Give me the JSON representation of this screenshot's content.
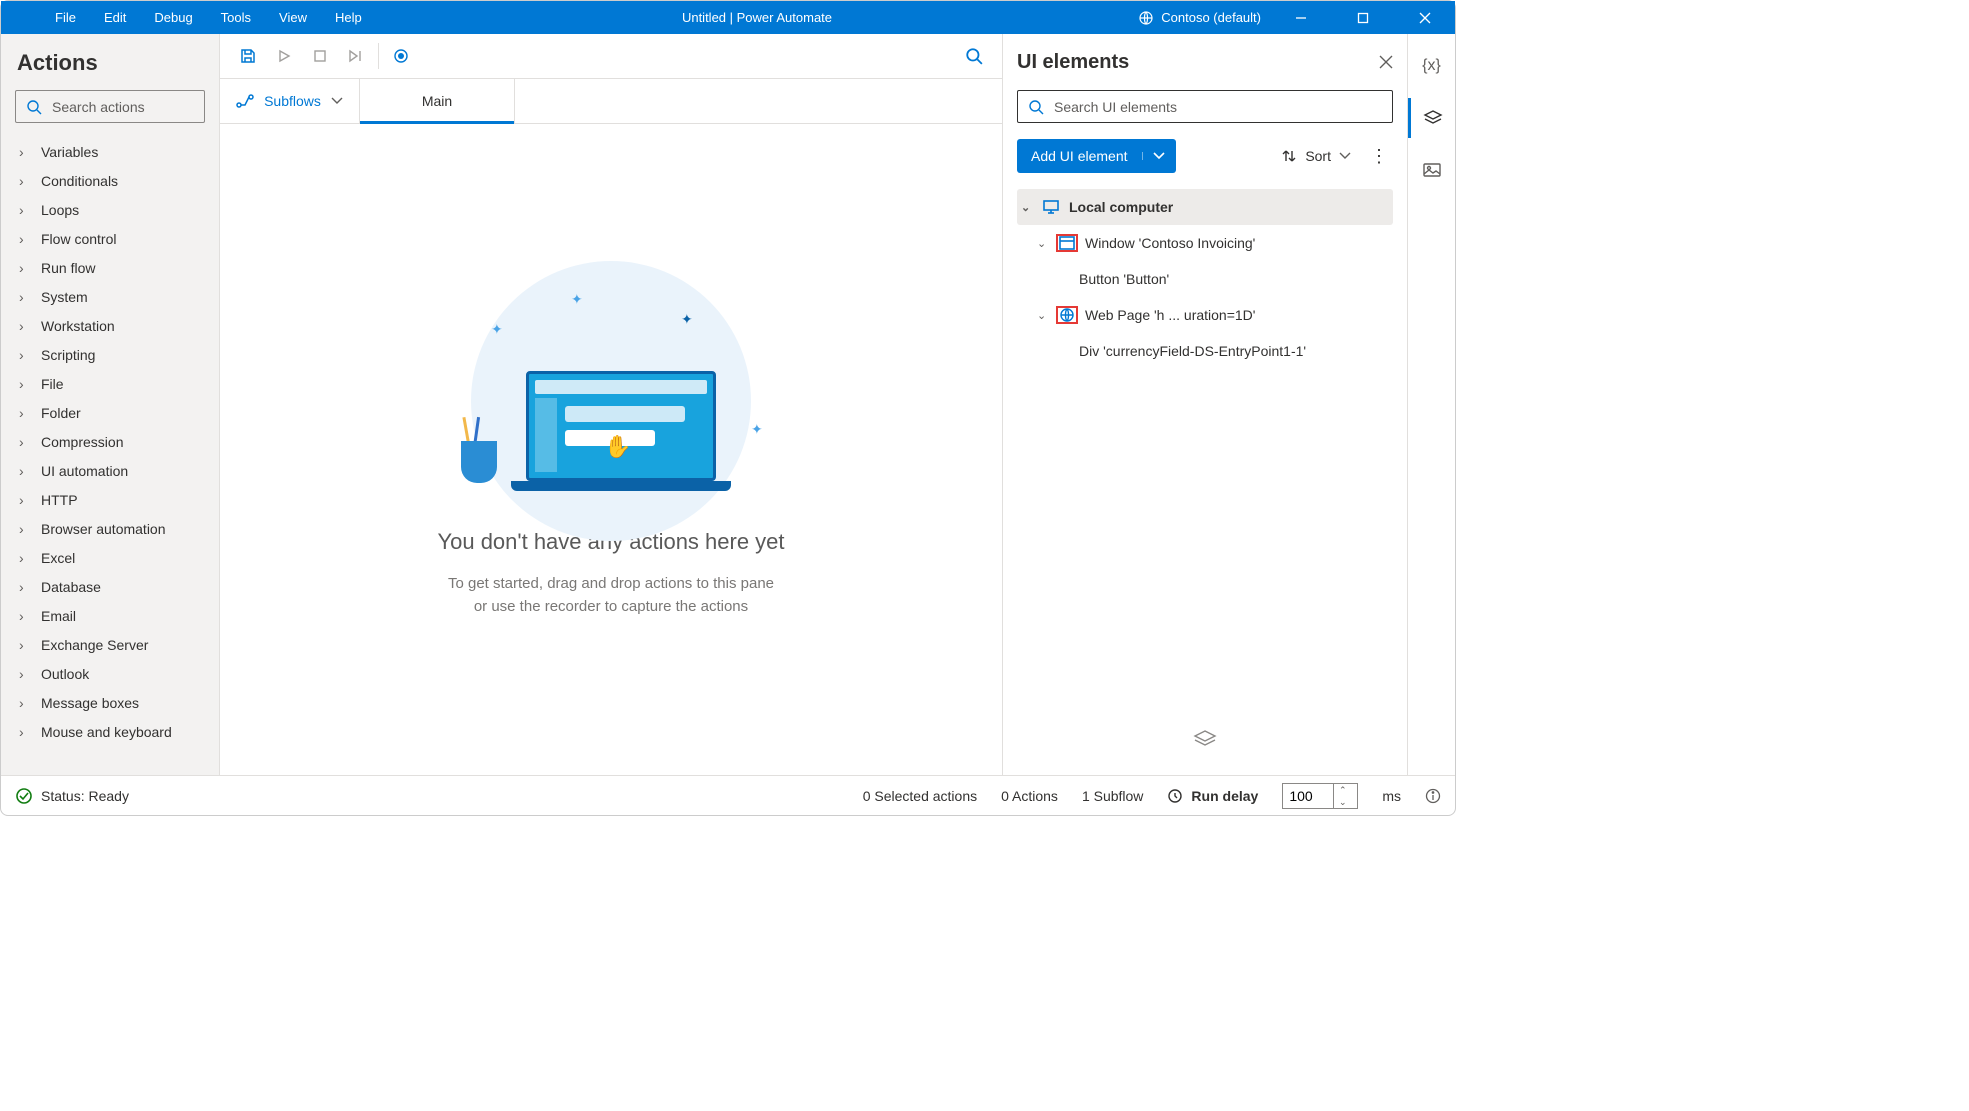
{
  "titlebar": {
    "menus": [
      "File",
      "Edit",
      "Debug",
      "Tools",
      "View",
      "Help"
    ],
    "title": "Untitled | Power Automate",
    "environment": "Contoso (default)"
  },
  "actions_panel": {
    "title": "Actions",
    "search_placeholder": "Search actions",
    "categories": [
      "Variables",
      "Conditionals",
      "Loops",
      "Flow control",
      "Run flow",
      "System",
      "Workstation",
      "Scripting",
      "File",
      "Folder",
      "Compression",
      "UI automation",
      "HTTP",
      "Browser automation",
      "Excel",
      "Database",
      "Email",
      "Exchange Server",
      "Outlook",
      "Message boxes",
      "Mouse and keyboard"
    ]
  },
  "tabs": {
    "subflows_label": "Subflows",
    "main_tab": "Main"
  },
  "canvas": {
    "headline": "You don't have any actions here yet",
    "sub1": "To get started, drag and drop actions to this pane",
    "sub2": "or use the recorder to capture the actions"
  },
  "right_panel": {
    "title": "UI elements",
    "search_placeholder": "Search UI elements",
    "add_label": "Add UI element",
    "sort_label": "Sort",
    "tree": {
      "root": "Local computer",
      "window": "Window 'Contoso Invoicing'",
      "button": "Button 'Button'",
      "webpage": "Web Page 'h ... uration=1D'",
      "div": "Div 'currencyField-DS-EntryPoint1-1'"
    }
  },
  "statusbar": {
    "status": "Status: Ready",
    "selected": "0 Selected actions",
    "actions_count": "0 Actions",
    "subflows": "1 Subflow",
    "run_delay_label": "Run delay",
    "run_delay_value": "100",
    "ms": "ms"
  }
}
